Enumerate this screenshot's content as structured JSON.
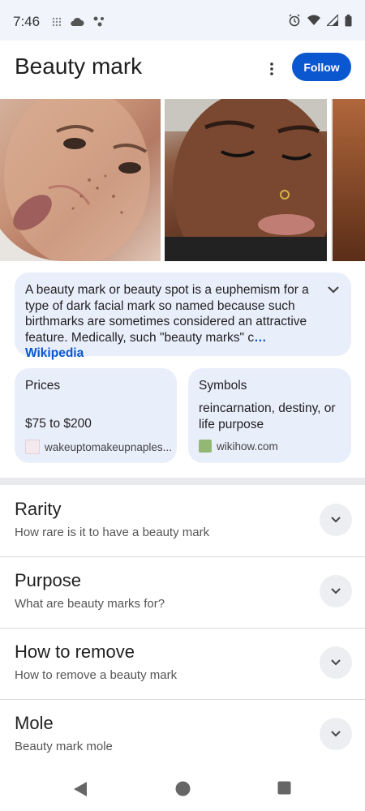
{
  "status_bar": {
    "time": "7:46",
    "left_icons": [
      "grid-icon",
      "cloud-icon",
      "assistant-icon"
    ],
    "right_icons": [
      "alarm-icon",
      "wifi-icon",
      "signal-icon",
      "battery-icon"
    ]
  },
  "header": {
    "title": "Beauty mark",
    "follow_label": "Follow"
  },
  "images": [
    "face-with-freckles-image",
    "face-with-nose-ring-image",
    "partial-face-image"
  ],
  "wiki": {
    "snippet": "A beauty mark or beauty spot is a euphemism for a type of dark facial mark so named because such birthmarks are sometimes considered an attractive feature. Medically, such \"beauty marks\" c",
    "source": "… Wikipedia"
  },
  "cards": [
    {
      "title": "Prices",
      "value": "$75 to $200",
      "source": "wakeuptomakeupnaples..."
    },
    {
      "title": "Symbols",
      "value": "reincarnation, destiny, or life purpose",
      "source": "wikihow.com"
    }
  ],
  "rows": [
    {
      "title": "Rarity",
      "subtitle": "How rare is it to have a beauty mark"
    },
    {
      "title": "Purpose",
      "subtitle": "What are beauty marks for?"
    },
    {
      "title": "How to remove",
      "subtitle": "How to remove a beauty mark"
    },
    {
      "title": "Mole",
      "subtitle": "Beauty mark mole"
    }
  ],
  "colors": {
    "accent": "#0b57d0",
    "card_bg": "#e9eefb"
  }
}
